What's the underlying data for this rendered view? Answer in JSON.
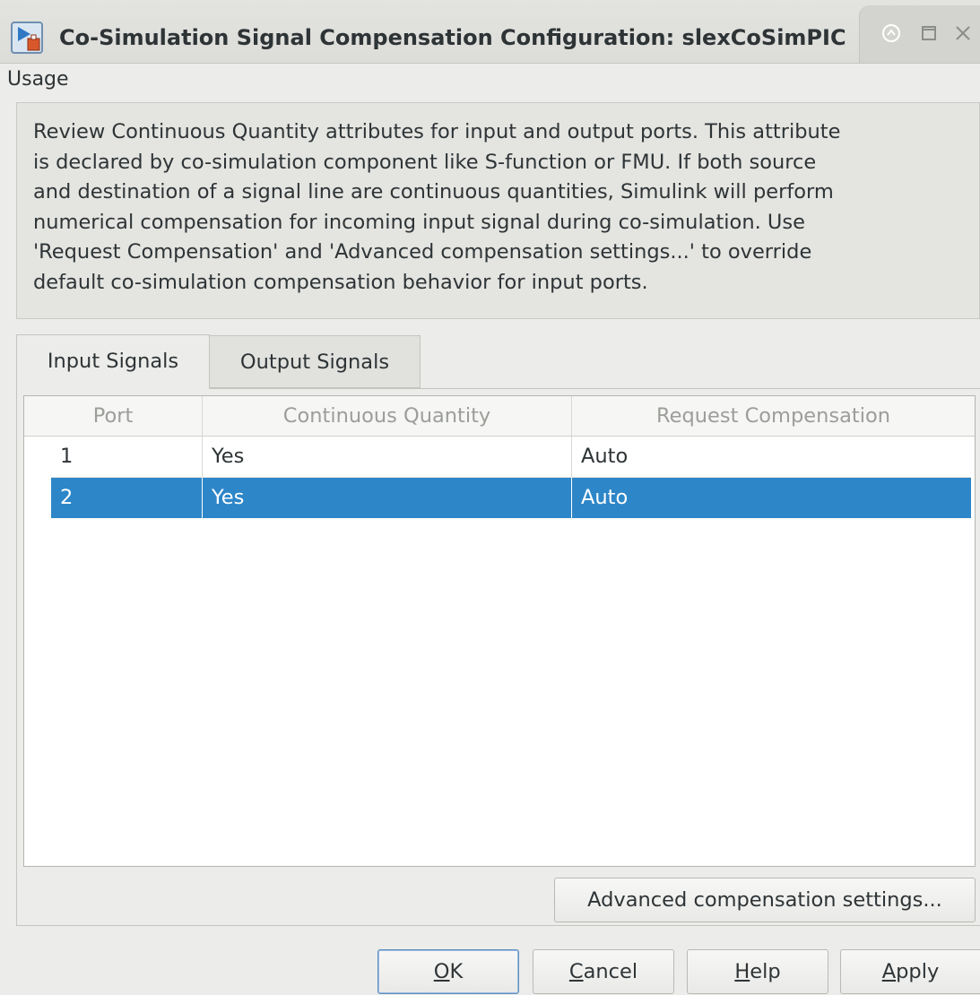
{
  "window": {
    "title": "Co-Simulation Signal Compensation Configuration: slexCoSimPIC",
    "controls": [
      "restore-icon",
      "maximize-icon",
      "close-icon"
    ]
  },
  "usage": {
    "label": "Usage",
    "lines": [
      "Review Continuous Quantity attributes for input and output ports. This attribute",
      "is declared by co-simulation component like S-function or FMU. If both source",
      "and destination of a signal line are continuous quantities, Simulink will perform",
      "numerical compensation for incoming input signal during co-simulation. Use",
      "'Request Compensation' and 'Advanced compensation settings...' to override",
      "default co-simulation compensation behavior for input ports."
    ]
  },
  "tabs": [
    {
      "label": "Input Signals",
      "active": true
    },
    {
      "label": "Output Signals",
      "active": false
    }
  ],
  "table": {
    "columns": [
      "Port",
      "Continuous Quantity",
      "Request Compensation"
    ],
    "rows": [
      {
        "port": "1",
        "continuous_quantity": "Yes",
        "request_compensation": "Auto",
        "selected": false
      },
      {
        "port": "2",
        "continuous_quantity": "Yes",
        "request_compensation": "Auto",
        "selected": true
      }
    ]
  },
  "buttons": {
    "advanced": "Advanced compensation settings...",
    "ok": {
      "mnemonic": "O",
      "rest": "K"
    },
    "cancel": {
      "mnemonic": "C",
      "rest": "ancel"
    },
    "help": {
      "mnemonic": "H",
      "rest": "elp"
    },
    "apply": {
      "mnemonic": "A",
      "rest": "pply"
    }
  },
  "colors": {
    "selection": "#2d86c8",
    "dialog_bg": "#ececea",
    "default_button_border": "#5f8fc0"
  }
}
